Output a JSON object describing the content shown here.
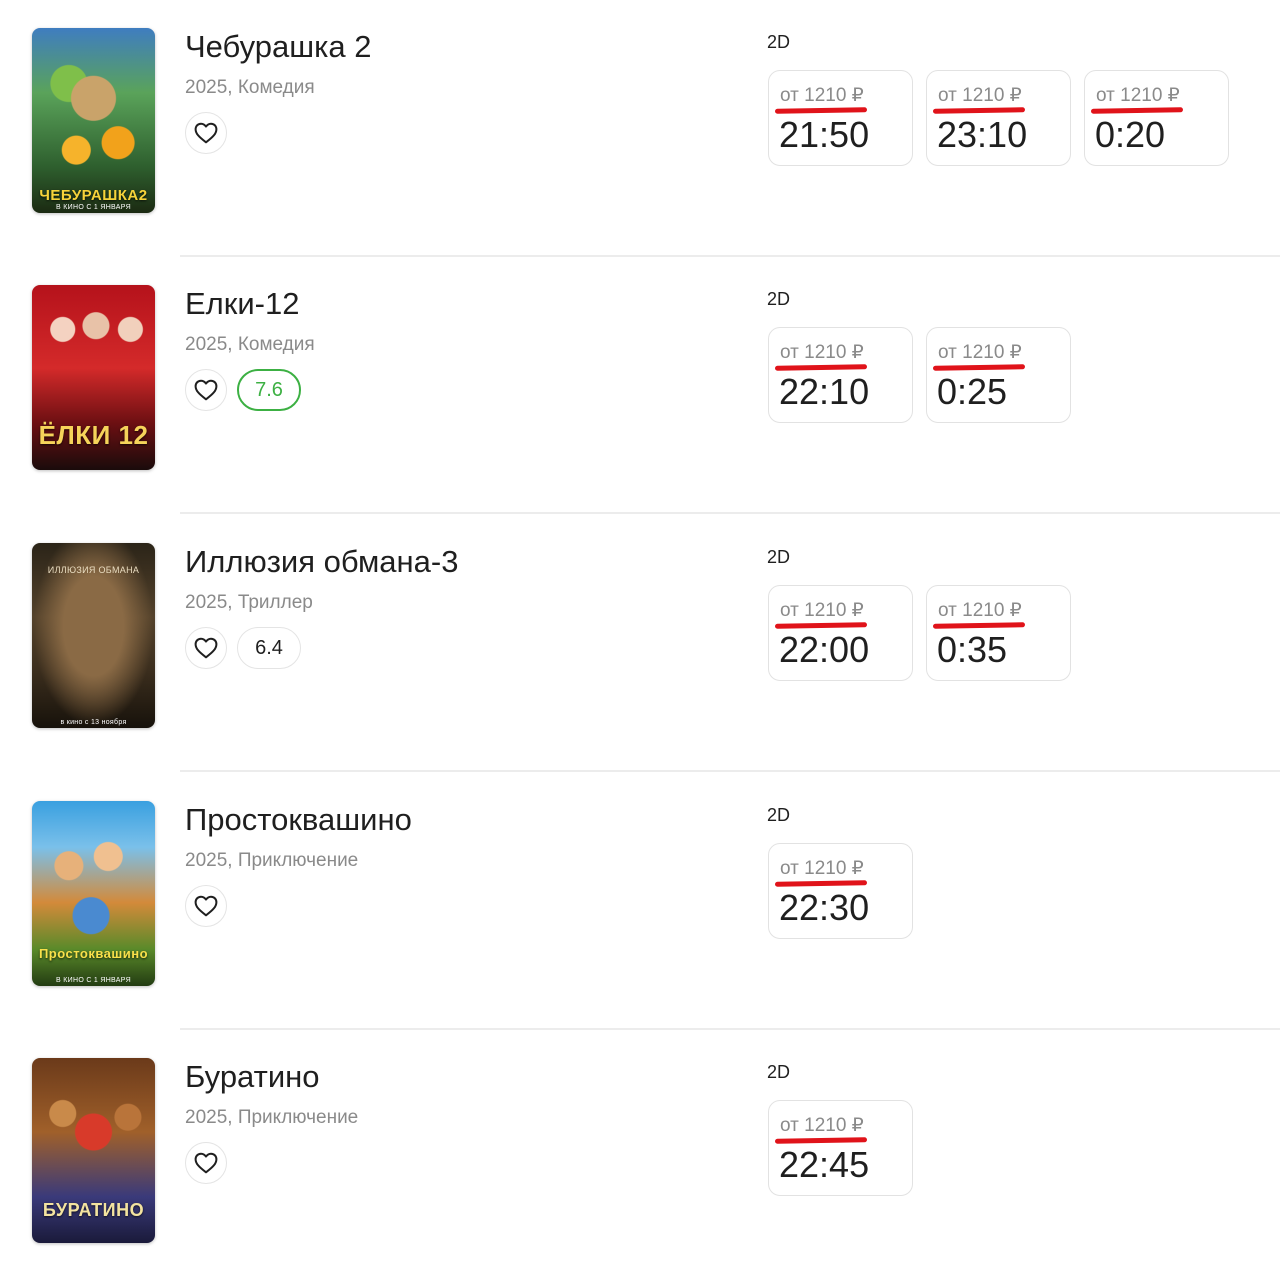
{
  "currency_note": "",
  "movies": [
    {
      "title": "Чебурашка 2",
      "meta": "2025, Комедия",
      "poster": {
        "caption": "ЧЕБУРАШКА2",
        "sub": "В КИНО С 1 ЯНВАРЯ",
        "top": ""
      },
      "rating": null,
      "format": "2D",
      "sessions": [
        {
          "price": "от 1210 ₽",
          "time": "21:50"
        },
        {
          "price": "от 1210 ₽",
          "time": "23:10"
        },
        {
          "price": "от 1210 ₽",
          "time": "0:20"
        }
      ]
    },
    {
      "title": "Елки-12",
      "meta": "2025, Комедия",
      "poster": {
        "caption": "ЁЛКИ 12",
        "sub": "",
        "top": ""
      },
      "rating": {
        "value": "7.6",
        "style": "good"
      },
      "format": "2D",
      "sessions": [
        {
          "price": "от 1210 ₽",
          "time": "22:10"
        },
        {
          "price": "от 1210 ₽",
          "time": "0:25"
        }
      ]
    },
    {
      "title": "Иллюзия обмана-3",
      "meta": "2025, Триллер",
      "poster": {
        "caption": "",
        "sub": "в кино с 13 ноября",
        "top": "ИЛЛЮЗИЯ ОБМАНА"
      },
      "rating": {
        "value": "6.4",
        "style": "neutral"
      },
      "format": "2D",
      "sessions": [
        {
          "price": "от 1210 ₽",
          "time": "22:00"
        },
        {
          "price": "от 1210 ₽",
          "time": "0:35"
        }
      ]
    },
    {
      "title": "Простоквашино",
      "meta": "2025, Приключение",
      "poster": {
        "caption": "Простоквашино",
        "sub": "В КИНО С 1 ЯНВАРЯ",
        "top": ""
      },
      "rating": null,
      "format": "2D",
      "sessions": [
        {
          "price": "от 1210 ₽",
          "time": "22:30"
        }
      ]
    },
    {
      "title": "Буратино",
      "meta": "2025, Приключение",
      "poster": {
        "caption": "БУРАТИНО",
        "sub": "",
        "top": ""
      },
      "rating": null,
      "format": "2D",
      "sessions": [
        {
          "price": "от 1210 ₽",
          "time": "22:45"
        }
      ]
    }
  ],
  "icons": {
    "favorite": "heart-outline-icon"
  },
  "colors": {
    "highlight_mark": "#e0131a",
    "rating_good": "#3cb043",
    "meta_text": "#8a8a8a"
  }
}
